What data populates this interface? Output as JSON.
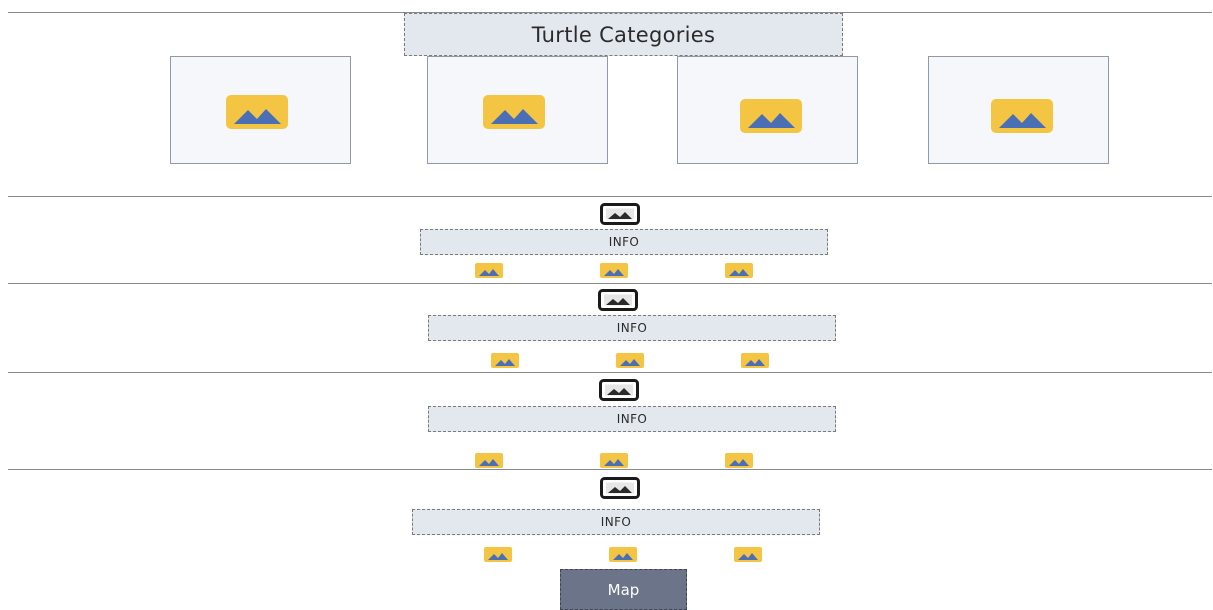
{
  "header": {
    "title": "Turtle Categories"
  },
  "categories": [
    {
      "icon": "image-placeholder-icon"
    },
    {
      "icon": "image-placeholder-icon"
    },
    {
      "icon": "image-placeholder-icon"
    },
    {
      "icon": "image-placeholder-icon"
    }
  ],
  "sections": [
    {
      "photo_icon": "photo-icon",
      "info_label": "INFO",
      "thumbnails": [
        "image-placeholder-icon",
        "image-placeholder-icon",
        "image-placeholder-icon"
      ]
    },
    {
      "photo_icon": "photo-icon",
      "info_label": "INFO",
      "thumbnails": [
        "image-placeholder-icon",
        "image-placeholder-icon",
        "image-placeholder-icon"
      ]
    },
    {
      "photo_icon": "photo-icon",
      "info_label": "INFO",
      "thumbnails": [
        "image-placeholder-icon",
        "image-placeholder-icon",
        "image-placeholder-icon"
      ]
    },
    {
      "photo_icon": "photo-icon",
      "info_label": "INFO",
      "thumbnails": [
        "image-placeholder-icon",
        "image-placeholder-icon",
        "image-placeholder-icon"
      ]
    }
  ],
  "footer": {
    "map_label": "Map"
  },
  "colors": {
    "placeholder_fill": "#f4c542",
    "placeholder_mountain": "#4a6fb5",
    "box_fill": "#e3e7ee",
    "map_button": "#6b7488"
  }
}
